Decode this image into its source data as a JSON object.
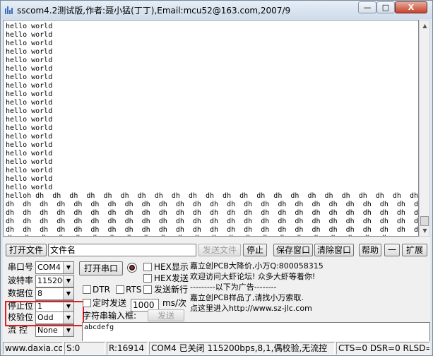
{
  "window": {
    "title": "sscom4.2测试版,作者:聂小猛(丁丁),Email:mcu52@163.com,2007/9",
    "minimize": "—",
    "maximize": "□",
    "close": "X"
  },
  "receive": {
    "lines": [
      "hello world",
      "hello world",
      "hello world",
      "hello world",
      "hello world",
      "hello world",
      "hello world",
      "hello world",
      "hello world",
      "hello world",
      "hello world",
      "hello world",
      "hello world",
      "hello world",
      "hello world",
      "hello world",
      "hello world",
      "hello world",
      "hello world",
      "hello world",
      "helloh dh  dh  dh  dh  dh  dh  dh  dh  dh  dh  dh  dh  dh  dh  dh  dh  dh  dh  dh  dh  dh  dh  dh  dh",
      "dh  dh  dh  dh  dh  dh  dh  dh  dh  dh  dh  dh  dh  dh  dh  dh  dh  dh  dh  dh  dh  dh  dh  dh  dh",
      "dh  dh  dh  dh  dh  dh  dh  dh  dh  dh  dh  dh  dh  dh  dh  dh  dh  dh  dh  dh  dh  dh  dh  dh  dh",
      "dh  dh  dh  dh  dh  dh  dh  dh  dh  dh  dh  dh  dh  dh  dh  dh  dh  dh  dh  dh  dh  dh  dh  dh  dh",
      "dh  dh  dh  dh  dh  dh  dh  dh  dh  dh  dh  dh  dh  dh  dh  dh  dh  dh  dh  dh  dh  dh  dh  dh  dh",
      "dh  dh  dh  dh  dh  dh  dh  dh  dh  dh  dh  dh  dh  dh  dh  dh  dh  dh  dh  dh  dh  dh  dh"
    ]
  },
  "file_row": {
    "open_file": "打开文件",
    "file_name": "文件名",
    "send_file": "发送文件",
    "stop": "停止",
    "save_window": "保存窗口",
    "clear_window": "清除窗口",
    "help": "帮助",
    "collapse": "一",
    "expand": "扩展"
  },
  "settings": {
    "port_label": "串口号",
    "port_value": "COM4",
    "baud_label": "波特率",
    "baud_value": "115200",
    "databits_label": "数据位",
    "databits_value": "8",
    "stopbits_label": "停止位",
    "stopbits_value": "1",
    "parity_label": "校验位",
    "parity_value": "Odd",
    "flow_label": "流 控",
    "flow_value": "None"
  },
  "controls": {
    "open_port": "打开串口",
    "hex_display": "HEX显示",
    "hex_send": "HEX发送",
    "dtr": "DTR",
    "rts": "RTS",
    "send_newline": "发送新行",
    "timed_send": "定时发送",
    "interval": "1000",
    "interval_unit": "ms/次",
    "input_label": "字符串输入框:",
    "send": "发送",
    "send_text": "abcdefg"
  },
  "ad": {
    "line1": "嘉立创PCB大降价,小万Q:800058315",
    "line2": "欢迎访问大虾论坛! 众多大虾等着你!",
    "line3": "---------以下为广告--------",
    "line4": "嘉立创PCB样品了,请找小万索取.",
    "line5": "点这里进入http://www.sz-jlc.com"
  },
  "status": {
    "site": "www.daxia.com",
    "sent": "S:0",
    "received": "R:16914",
    "port_state": "COM4 已关闭  115200bps,8,1,偶校验,无流控",
    "signals": "CTS=0 DSR=0 RLSD="
  }
}
